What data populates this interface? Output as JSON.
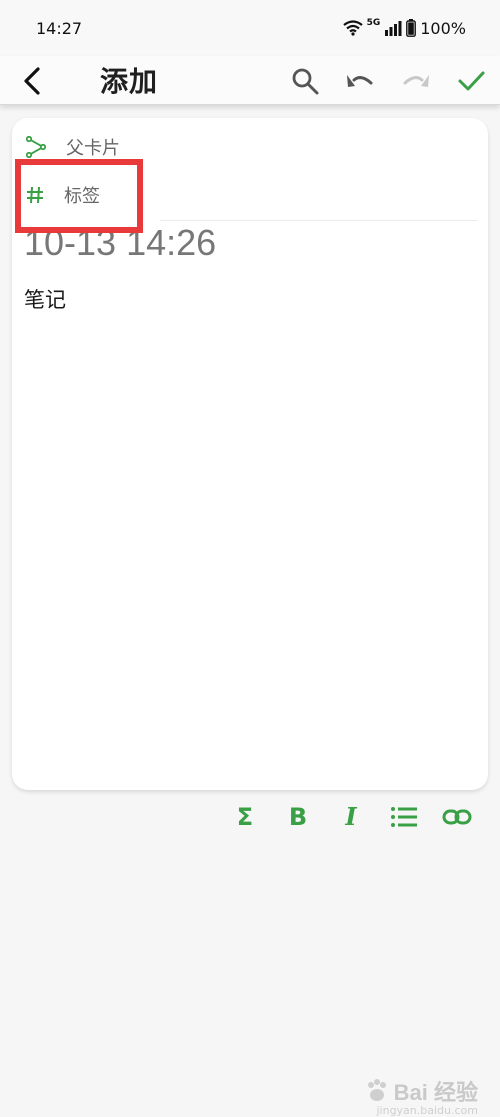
{
  "status_bar": {
    "time": "14:27",
    "network_label": "5G",
    "battery": "100%",
    "icons": [
      "wifi-icon",
      "signal-icon",
      "battery-icon"
    ]
  },
  "toolbar": {
    "title": "添加",
    "icons": [
      "back-arrow-icon",
      "search-icon",
      "undo-icon",
      "redo-icon",
      "check-icon"
    ]
  },
  "card": {
    "parent_card_label": "父卡片",
    "tags_label": "标签",
    "date_heading": "10-13 14:26",
    "note_text": "笔记"
  },
  "format_toolbar": {
    "items": [
      {
        "name": "sum",
        "glyph": "Σ"
      },
      {
        "name": "bold",
        "glyph": "B"
      },
      {
        "name": "italic",
        "glyph": "I"
      },
      {
        "name": "list",
        "glyph": "list-icon"
      },
      {
        "name": "link",
        "glyph": "link-icon"
      }
    ]
  },
  "watermark": {
    "text": "Bai  经验",
    "sub": "jingyan.baidu.com"
  },
  "colors": {
    "accent_green": "#3aa046",
    "highlight_red": "#e83a3a",
    "redo_disabled": "#c8c8c8"
  }
}
